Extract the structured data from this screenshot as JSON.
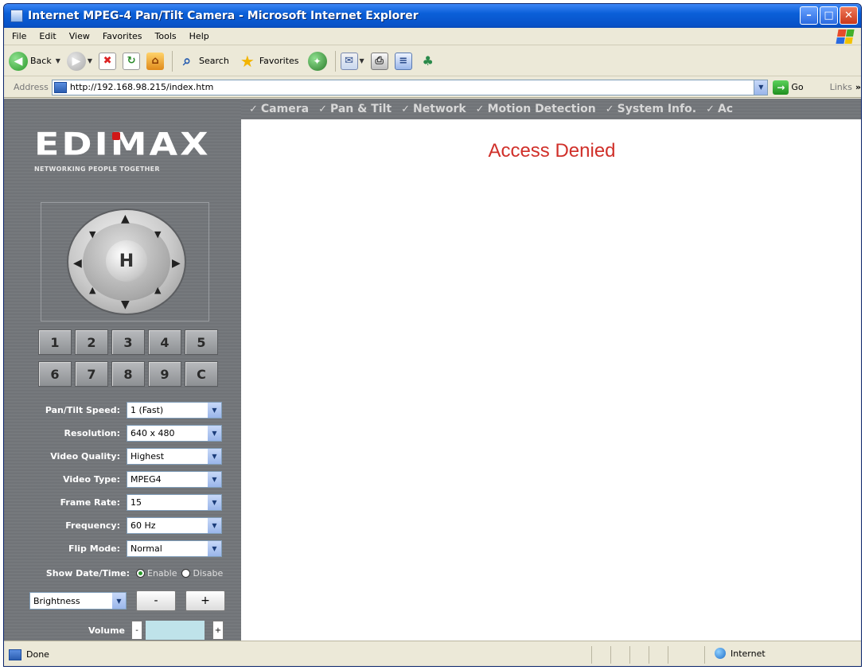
{
  "window": {
    "title": "Internet MPEG-4 Pan/Tilt Camera - Microsoft Internet Explorer",
    "minimize": "–",
    "maximize": "□",
    "close": "✕"
  },
  "menu": {
    "items": [
      "File",
      "Edit",
      "View",
      "Favorites",
      "Tools",
      "Help"
    ]
  },
  "toolbar": {
    "back_label": "Back",
    "search_label": "Search",
    "favorites_label": "Favorites"
  },
  "address": {
    "label": "Address",
    "url": "http://192.168.98.215/index.htm",
    "go_label": "Go",
    "links_label": "Links",
    "links_more": "»"
  },
  "brand": {
    "logo": "EDIMAX",
    "tagline": "NETWORKING PEOPLE TOGETHER"
  },
  "nav": {
    "items": [
      "Camera",
      "Pan & Tilt",
      "Network",
      "Motion Detection",
      "System Info.",
      "Ac"
    ]
  },
  "ptz": {
    "home_label": "H"
  },
  "presets": {
    "row1": [
      "1",
      "2",
      "3",
      "4",
      "5"
    ],
    "row2": [
      "6",
      "7",
      "8",
      "9",
      "C"
    ]
  },
  "settings": [
    {
      "label": "Pan/Tilt Speed:",
      "value": "1 (Fast)"
    },
    {
      "label": "Resolution:",
      "value": "640 x 480"
    },
    {
      "label": "Video Quality:",
      "value": "Highest"
    },
    {
      "label": "Video Type:",
      "value": "MPEG4"
    },
    {
      "label": "Frame Rate:",
      "value": "15"
    },
    {
      "label": "Frequency:",
      "value": "60 Hz"
    },
    {
      "label": "Flip Mode:",
      "value": "Normal"
    }
  ],
  "datetime": {
    "label": "Show Date/Time:",
    "enable": "Enable",
    "disable": "Disabe",
    "selected": "Enable"
  },
  "brightness": {
    "selected": "Brightness",
    "minus": "-",
    "plus": "+"
  },
  "volume": {
    "label": "Volume",
    "minus": "-",
    "plus": "+"
  },
  "content": {
    "message": "Access Denied"
  },
  "status": {
    "text": "Done",
    "zone": "Internet"
  },
  "colors": {
    "accent_red": "#d0302a",
    "titlebar_blue": "#0a5fd8",
    "sidebar_gray": "#737679"
  }
}
